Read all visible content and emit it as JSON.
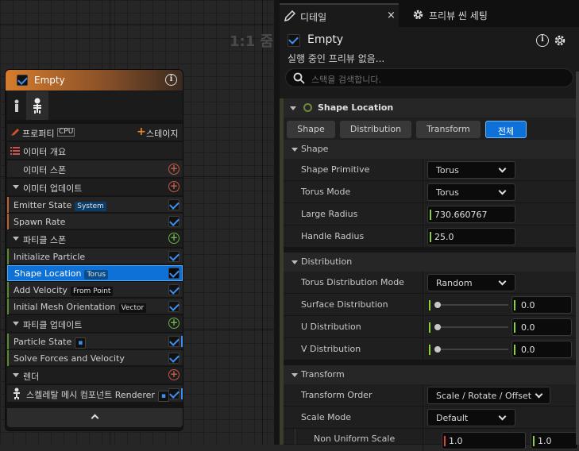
{
  "graph": {
    "zoom_label": "1:1 줌"
  },
  "node": {
    "title": "Empty",
    "tabs": {
      "properties_label": "프로퍼티",
      "cpu_label": "CPU",
      "stage_label": "스테이지"
    },
    "rows": [
      {
        "kind": "item",
        "label": "이미터 개요",
        "icon": "list-icon"
      },
      {
        "kind": "item",
        "label": "이미터 스폰",
        "add": "red"
      },
      {
        "kind": "section",
        "label": "이미터 업데이트",
        "add": "red"
      },
      {
        "kind": "module",
        "label": "Emitter State",
        "tag": "System",
        "checked": true
      },
      {
        "kind": "module",
        "label": "Spawn Rate",
        "checked": true
      },
      {
        "kind": "section",
        "label": "파티클 스폰",
        "add": "green"
      },
      {
        "kind": "module",
        "label": "Initialize Particle",
        "checked": true
      },
      {
        "kind": "module",
        "label": "Shape Location",
        "tag": "Torus",
        "checked": true,
        "selected": true
      },
      {
        "kind": "module",
        "label": "Add Velocity",
        "tag": "From Point",
        "checked": true
      },
      {
        "kind": "module",
        "label": "Initial Mesh Orientation",
        "tag": "Vector",
        "checked": true
      },
      {
        "kind": "section",
        "label": "파티클 업데이트",
        "add": "green"
      },
      {
        "kind": "module",
        "label": "Particle State",
        "tag": "▪",
        "checked": true
      },
      {
        "kind": "module",
        "label": "Solve Forces and Velocity",
        "checked": true
      },
      {
        "kind": "section",
        "label": "렌더",
        "add": "red"
      },
      {
        "kind": "module",
        "label": "스켈레탈 메시 컴포넌트 Renderer",
        "tag": "▪",
        "checked": true
      }
    ],
    "collapse_glyph": "^"
  },
  "panel": {
    "tabs": [
      {
        "label": "디테일",
        "icon": "pencil-icon"
      },
      {
        "label": "프리뷰 씬 세팅",
        "icon": "gear-icon"
      }
    ],
    "close_glyph": "×",
    "object_name": "Empty",
    "status": "실행 중인 프리뷰 없음...",
    "search_placeholder": "스택을 검색합니다.",
    "module_title": "Shape Location",
    "filter_buttons": [
      "Shape",
      "Distribution",
      "Transform",
      "전체"
    ],
    "categories": [
      {
        "label": "Shape",
        "props": [
          {
            "name": "Shape Primitive",
            "type": "combo",
            "value": "Torus"
          },
          {
            "name": "Torus Mode",
            "type": "combo",
            "value": "Torus"
          },
          {
            "name": "Large Radius",
            "type": "num",
            "value": "730.660767"
          },
          {
            "name": "Handle Radius",
            "type": "num",
            "value": "25.0"
          }
        ]
      },
      {
        "label": "Distribution",
        "props": [
          {
            "name": "Torus Distribution Mode",
            "type": "combo",
            "value": "Random"
          },
          {
            "name": "Surface Distribution",
            "type": "slider",
            "value": "0.0"
          },
          {
            "name": "U Distribution",
            "type": "slider",
            "value": "0.0"
          },
          {
            "name": "V Distribution",
            "type": "slider",
            "value": "0.0"
          }
        ]
      },
      {
        "label": "Transform",
        "props": [
          {
            "name": "Transform Order",
            "type": "combo",
            "value": "Scale / Rotate / Offset"
          },
          {
            "name": "Scale Mode",
            "type": "combo",
            "value": "Default"
          },
          {
            "name": "Non Uniform Scale",
            "type": "vec",
            "values": [
              "1.0",
              "1.0"
            ]
          }
        ]
      }
    ]
  },
  "colors": {
    "accent": "#0e71d8",
    "node_header": "#d67c2c",
    "check": "#3d8ff2"
  }
}
